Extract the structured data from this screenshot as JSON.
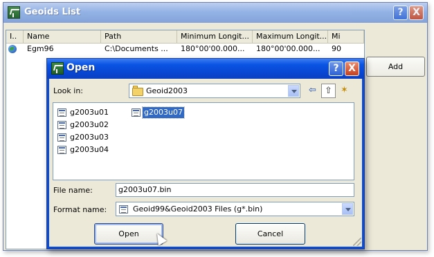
{
  "outer_window": {
    "title": "Geoids List",
    "icon": "app-icon",
    "title_buttons": {
      "help": "?",
      "close": "X"
    },
    "columns": [
      "I..",
      "Name",
      "Path",
      "Minimum Longit...",
      "Maximum Longit...",
      "Mi"
    ],
    "rows": [
      {
        "icon": "globe-icon",
        "name": "Egm96",
        "path": "C:\\Documents ...",
        "min_longitude": "180°00'00.000...",
        "max_longitude": "180°00'00.000...",
        "mi": "90"
      }
    ],
    "add_label": "Add"
  },
  "open_dialog": {
    "title": "Open",
    "title_buttons": {
      "help": "?",
      "close": "X"
    },
    "look_in_label": "Look in:",
    "look_in_value": "Geoid2003",
    "toolbar_icons": [
      "back-icon",
      "up-folder-icon",
      "new-folder-icon"
    ],
    "toolbar_glyphs": {
      "back": "⇦",
      "up": "⇧",
      "new": "✶"
    },
    "files": [
      {
        "name": "g2003u01",
        "selected": false
      },
      {
        "name": "g2003u02",
        "selected": false
      },
      {
        "name": "g2003u03",
        "selected": false
      },
      {
        "name": "g2003u04",
        "selected": false
      },
      {
        "name": "g2003u07",
        "selected": true
      }
    ],
    "file_name_label": "File name:",
    "file_name_value": "g2003u07.bin",
    "format_name_label": "Format name:",
    "format_name_value": "Geoid99&Geoid2003 Files (g*.bin)",
    "open_label": "Open",
    "cancel_label": "Cancel"
  },
  "colors": {
    "selection": "#316ac5",
    "title_active": "#0a54e3",
    "title_inactive": "#8fb0e6",
    "dialog_face": "#ece9d8"
  }
}
